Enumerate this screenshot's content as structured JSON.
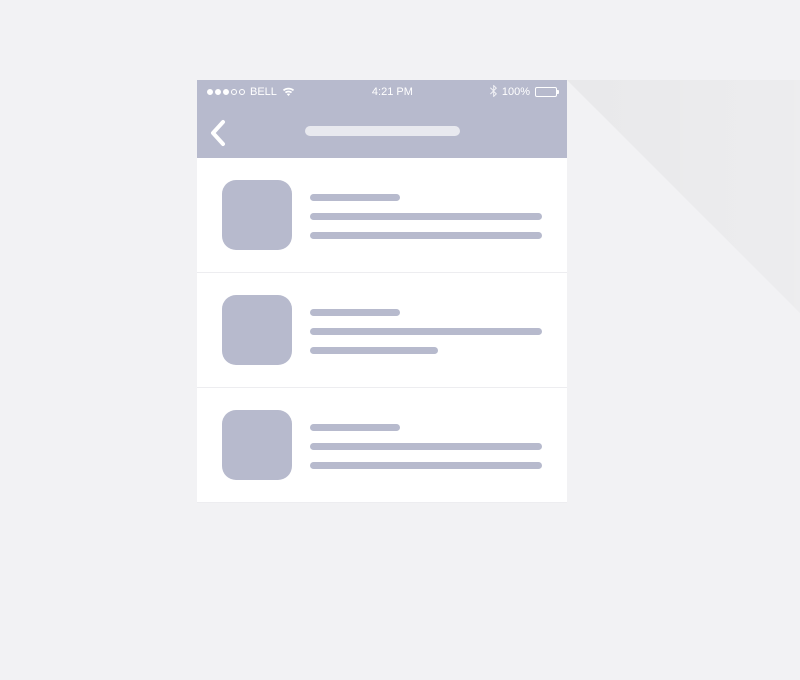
{
  "status_bar": {
    "carrier": "BELL",
    "time": "4:21 PM",
    "battery_percent": "100%"
  },
  "nav": {
    "back_label": "Back",
    "title_placeholder": ""
  },
  "list": {
    "items": [
      {
        "title": "",
        "line1": "",
        "line2": ""
      },
      {
        "title": "",
        "line1": "",
        "line2": ""
      },
      {
        "title": "",
        "line1": "",
        "line2": ""
      }
    ]
  },
  "colors": {
    "accent": "#b7bacd",
    "background": "#f2f2f4"
  }
}
